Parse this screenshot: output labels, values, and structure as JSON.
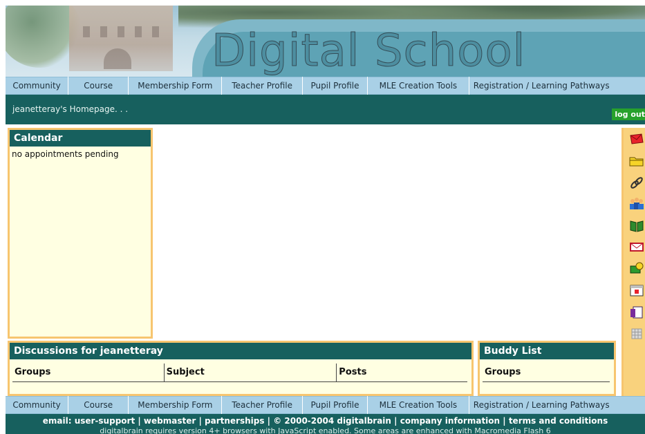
{
  "banner": {
    "title": "Digital School"
  },
  "nav": {
    "items": [
      "Community",
      "Course",
      "Membership Form",
      "Teacher Profile",
      "Pupil Profile",
      "MLE Creation Tools",
      "Registration / Learning Pathways"
    ]
  },
  "greeting": {
    "text": "jeanetteray's Homepage. . .",
    "logout_label": "log out"
  },
  "calendar": {
    "title": "Calendar",
    "status": "no appointments pending"
  },
  "discussions": {
    "title": "Discussions for jeanetteray",
    "columns": [
      "Groups",
      "Subject",
      "Posts"
    ]
  },
  "buddy": {
    "title": "Buddy List",
    "columns": [
      "Groups"
    ]
  },
  "toolbar_icons": [
    "mail-icon",
    "folder-icon",
    "link-icon",
    "people-icon",
    "book-icon",
    "message-icon",
    "chat-icon",
    "calendar-icon",
    "notes-icon",
    "grid-icon"
  ],
  "footer": {
    "links": "email: user-support | webmaster | partnerships | © 2000-2004 digitalbrain | company information | terms and conditions",
    "note": "digitalbrain requires version 4+ browsers with JavaScript enabled. Some areas are enhanced with Macromedia Flash 6"
  },
  "colors": {
    "teal": "#17605e",
    "nav": "#a9d0e6",
    "panel_border": "#f7c56f",
    "logout": "#27a12b"
  }
}
